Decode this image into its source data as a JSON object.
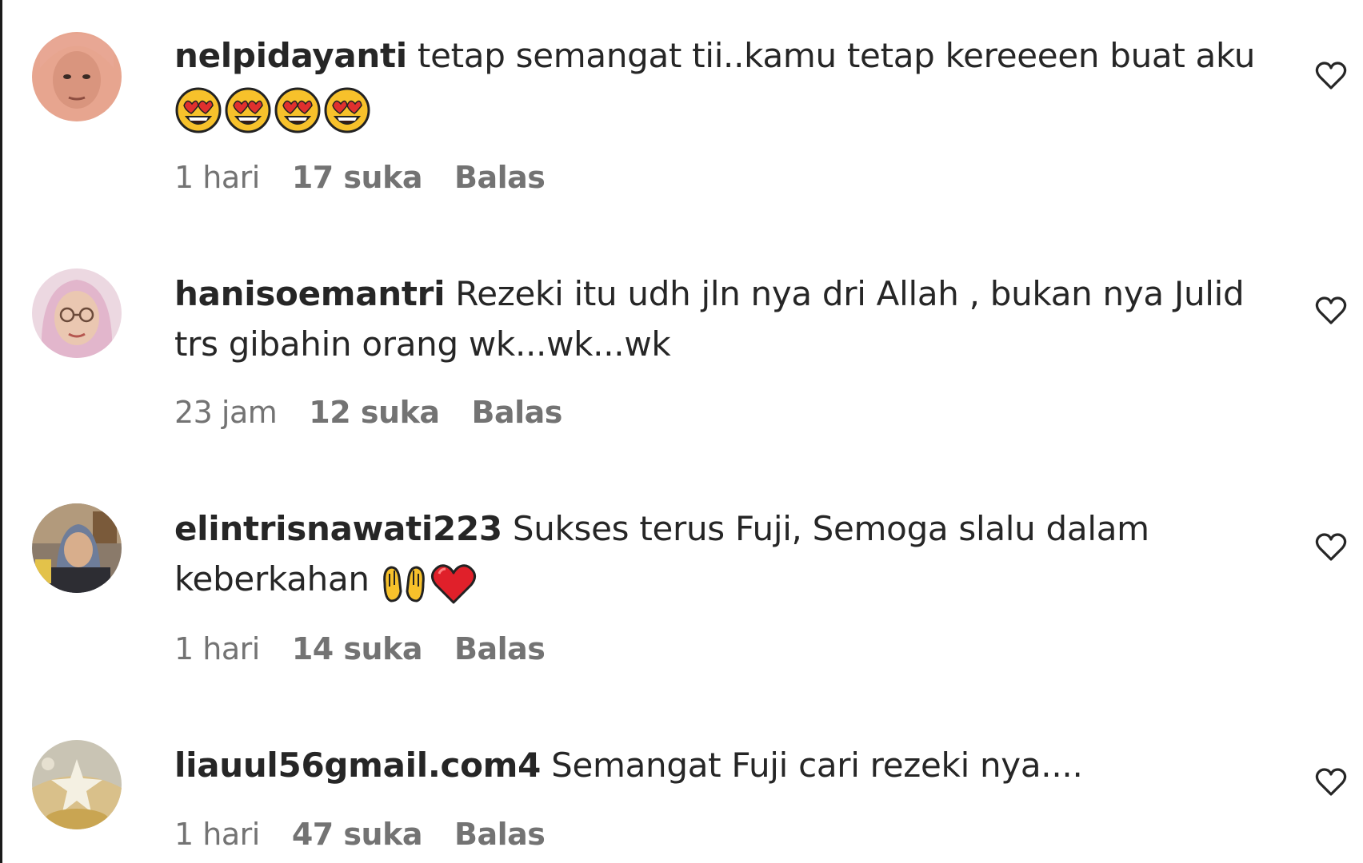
{
  "comments": [
    {
      "username": "nelpidayanti",
      "text": "tetap semangat tii..kamu tetap kereeeen buat aku",
      "emojis": [
        "heart-eyes-emoji",
        "heart-eyes-emoji",
        "heart-eyes-emoji",
        "heart-eyes-emoji"
      ],
      "time": "1 hari",
      "likes": "17 suka",
      "reply": "Balas"
    },
    {
      "username": "hanisoemantri",
      "text": "Rezeki itu udh jln nya dri Allah , bukan nya Julid trs gibahin orang wk...wk...wk",
      "emojis": [],
      "time": "23 jam",
      "likes": "12 suka",
      "reply": "Balas"
    },
    {
      "username": "elintrisnawati223",
      "text": "Sukses terus Fuji, Semoga slalu dalam keberkahan",
      "emojis": [
        "open-hands-emoji",
        "red-heart-emoji"
      ],
      "time": "1 hari",
      "likes": "14 suka",
      "reply": "Balas"
    },
    {
      "username": "liauul56gmail.com4",
      "text": "Semangat Fuji cari rezeki nya....",
      "emojis": [],
      "time": "1 hari",
      "likes": "47 suka",
      "reply": "Balas"
    }
  ],
  "icons": {
    "like": "heart-outline-icon"
  },
  "colors": {
    "text": "#262626",
    "secondary": "#737373",
    "background": "#ffffff"
  }
}
